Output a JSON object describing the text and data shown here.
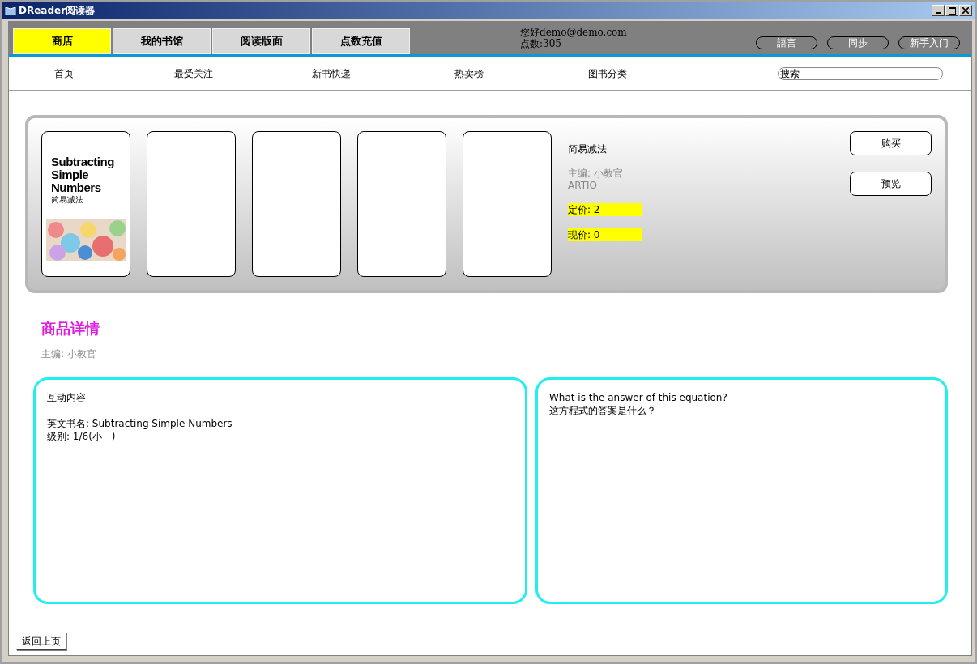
{
  "window": {
    "title": "DReader阅读器"
  },
  "tabs": [
    {
      "label": "商店",
      "selected": true
    },
    {
      "label": "我的书馆",
      "selected": false
    },
    {
      "label": "阅读版面",
      "selected": false
    },
    {
      "label": "点数充值",
      "selected": false
    }
  ],
  "user": {
    "greeting": "您好demo@demo.com",
    "points": "点数:305"
  },
  "header_buttons": [
    "語言",
    "同步",
    "新手入门"
  ],
  "nav": [
    "首页",
    "最受关注",
    "新书快递",
    "热卖榜",
    "图书分类"
  ],
  "search": {
    "value": "搜索"
  },
  "featured": {
    "cover": {
      "title": "Subtracting Simple Numbers",
      "subtitle": "简易减法"
    },
    "book_title": "简易减法",
    "editor": "主编: 小教官",
    "publisher": "ARTIO",
    "list_price": "定价: 2",
    "current_price": "现价: 0",
    "buttons": [
      "购买",
      "预览"
    ]
  },
  "details": {
    "heading": "商品详情",
    "editor": "主编: 小教官",
    "left_panel": {
      "title": "互动内容",
      "lines": [
        "英文书名: Subtracting Simple Numbers",
        "级别: 1/6(小一)"
      ]
    },
    "right_panel": {
      "lines": [
        "What is the answer of this equation?",
        "这方程式的答案是什么？"
      ]
    }
  },
  "back_button": "返回上页"
}
